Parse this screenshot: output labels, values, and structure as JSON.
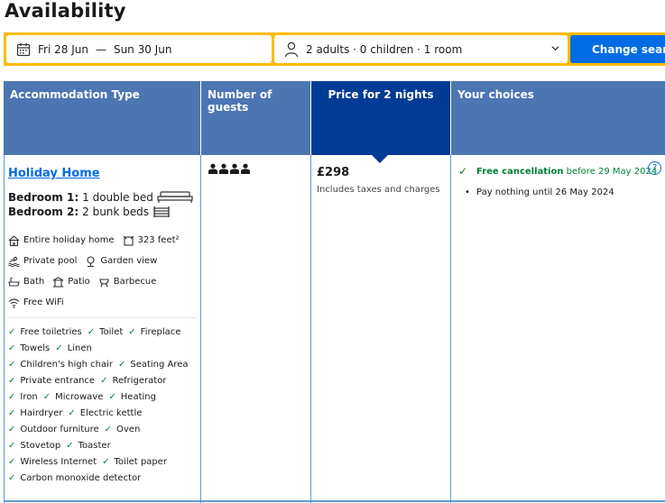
{
  "page": {
    "title": "Availability"
  },
  "search": {
    "checkin": "Fri 28 Jun",
    "separator": "—",
    "checkout": "Sun 30 Jun",
    "guests": "2 adults · 0 children · 1 room",
    "button": "Change search",
    "accent_color": "#febb02",
    "button_color": "#006ce4"
  },
  "table": {
    "headers": {
      "accommodation": "Accommodation Type",
      "guests": "Number of guests",
      "price": "Price for 2 nights",
      "choices": "Your choices"
    },
    "header_color": "#4c76b2",
    "active_header_color": "#003b95"
  },
  "room": {
    "name": "Holiday Home",
    "bedrooms": [
      {
        "label": "Bedroom 1:",
        "value": "1 double bed",
        "icon": "double-bed-icon"
      },
      {
        "label": "Bedroom 2:",
        "value": "2 bunk beds",
        "icon": "bunk-bed-icon"
      }
    ],
    "facilities": [
      [
        {
          "label": "Entire holiday home",
          "icon": "house-icon"
        },
        {
          "label": "323 feet²",
          "icon": "area-icon"
        }
      ],
      [
        {
          "label": "Private pool",
          "icon": "pool-icon"
        },
        {
          "label": "Garden view",
          "icon": "tree-icon"
        }
      ],
      [
        {
          "label": "Bath",
          "icon": "bath-icon"
        },
        {
          "label": "Patio",
          "icon": "patio-icon"
        },
        {
          "label": "Barbecue",
          "icon": "barbecue-icon"
        }
      ],
      [
        {
          "label": "Free WiFi",
          "icon": "wifi-icon"
        }
      ]
    ],
    "amenities": [
      [
        "Free toiletries",
        "Toilet",
        "Fireplace"
      ],
      [
        "Towels",
        "Linen"
      ],
      [
        "Children's high chair",
        "Seating Area"
      ],
      [
        "Private entrance",
        "Refrigerator"
      ],
      [
        "Iron",
        "Microwave",
        "Heating"
      ],
      [
        "Hairdryer",
        "Electric kettle"
      ],
      [
        "Outdoor furniture",
        "Oven"
      ],
      [
        "Stovetop",
        "Toaster"
      ],
      [
        "Wireless Internet",
        "Toilet paper"
      ],
      [
        "Carbon monoxide detector"
      ]
    ],
    "max_guests": 4
  },
  "price": {
    "amount": "£298",
    "note": "Includes taxes and charges"
  },
  "choices": {
    "cancellation_bold": "Free cancellation",
    "cancellation_rest": " before 29 May 2024",
    "payment": "Pay nothing until 26 May 2024",
    "help": "?"
  }
}
